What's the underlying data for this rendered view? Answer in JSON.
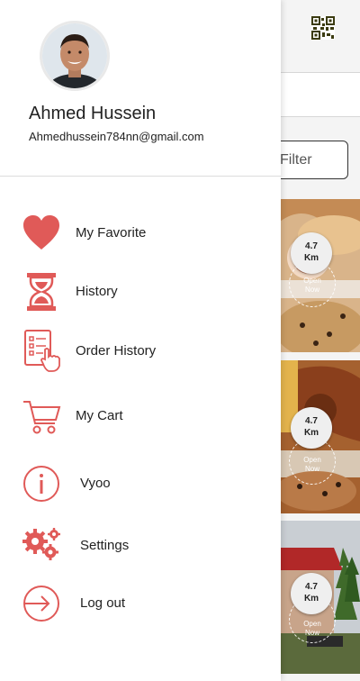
{
  "user": {
    "name": "Ahmed Hussein",
    "email": "Ahmedhussein784nn@gmail.com"
  },
  "menu": [
    {
      "label": "My Favorite",
      "icon": "heart-icon"
    },
    {
      "label": "History",
      "icon": "hourglass-icon"
    },
    {
      "label": "Order History",
      "icon": "order-list-icon"
    },
    {
      "label": "My Cart",
      "icon": "cart-icon"
    },
    {
      "label": "Vyoo",
      "icon": "info-icon"
    },
    {
      "label": "Settings",
      "icon": "gears-icon"
    },
    {
      "label": "Log out",
      "icon": "logout-icon"
    }
  ],
  "background": {
    "filter_label": "Filter",
    "cards": [
      {
        "distance_value": "4.7",
        "distance_unit": "Km",
        "status_line1": "Open",
        "status_line2": "Now"
      },
      {
        "distance_value": "4.7",
        "distance_unit": "Km",
        "status_line1": "Open",
        "status_line2": "Now"
      },
      {
        "distance_value": "4.7",
        "distance_unit": "Km",
        "status_line1": "Open",
        "status_line2": "Now"
      }
    ]
  },
  "colors": {
    "accent": "#e05a58",
    "text": "#222222"
  }
}
